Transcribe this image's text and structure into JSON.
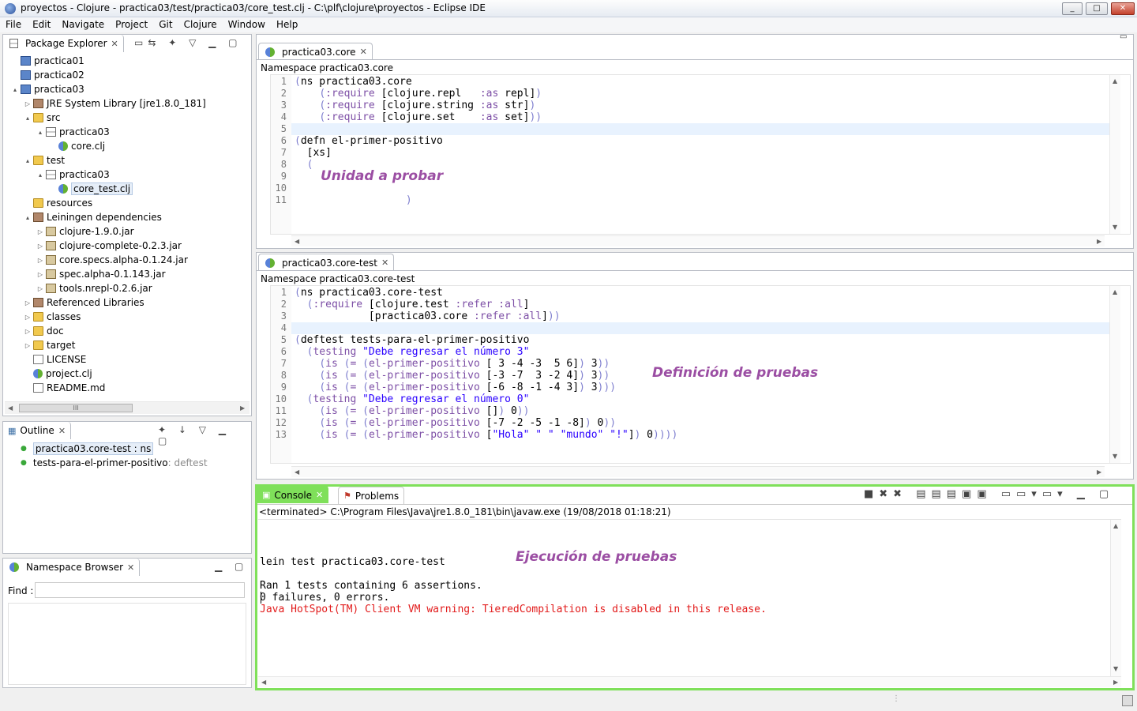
{
  "window": {
    "title": "proyectos - Clojure - practica03/test/practica03/core_test.clj - C:\\plf\\clojure\\proyectos - Eclipse IDE",
    "min": "_",
    "max": "□",
    "close": "✕"
  },
  "menu": [
    "File",
    "Edit",
    "Navigate",
    "Project",
    "Git",
    "Clojure",
    "Window",
    "Help"
  ],
  "package_explorer": {
    "title": "Package Explorer",
    "items": [
      {
        "label": "practica01"
      },
      {
        "label": "practica02"
      },
      {
        "label": "practica03"
      },
      {
        "label": "JRE System Library [jre1.8.0_181]"
      },
      {
        "label": "src"
      },
      {
        "label": "practica03"
      },
      {
        "label": "core.clj"
      },
      {
        "label": "test"
      },
      {
        "label": "practica03"
      },
      {
        "label": "core_test.clj"
      },
      {
        "label": "resources"
      },
      {
        "label": "Leiningen dependencies"
      },
      {
        "label": "clojure-1.9.0.jar"
      },
      {
        "label": "clojure-complete-0.2.3.jar"
      },
      {
        "label": "core.specs.alpha-0.1.24.jar"
      },
      {
        "label": "spec.alpha-0.1.143.jar"
      },
      {
        "label": "tools.nrepl-0.2.6.jar"
      },
      {
        "label": "Referenced Libraries"
      },
      {
        "label": "classes"
      },
      {
        "label": "doc"
      },
      {
        "label": "target"
      },
      {
        "label": "LICENSE"
      },
      {
        "label": "project.clj"
      },
      {
        "label": "README.md"
      }
    ],
    "hscroll_thumb": "III"
  },
  "outline": {
    "title": "Outline",
    "items": [
      {
        "name": "practica03.core-test",
        "kind": " : ns"
      },
      {
        "name": "tests-para-el-primer-positivo",
        "kind": " : deftest"
      }
    ]
  },
  "ns_browser": {
    "title": "Namespace Browser",
    "find_label": "Find :",
    "find_value": ""
  },
  "editor1": {
    "tab": "practica03.core",
    "namespace": "Namespace practica03.core",
    "line_numbers": [
      "1",
      "2",
      "3",
      "4",
      "5",
      "6",
      "7",
      "8",
      "9",
      "10",
      "11"
    ],
    "annotation": "Unidad a probar"
  },
  "editor2": {
    "tab": "practica03.core-test",
    "namespace": "Namespace practica03.core-test",
    "line_numbers": [
      "1",
      "2",
      "3",
      "4",
      "5",
      "6",
      "7",
      "8",
      "9",
      "10",
      "11",
      "12",
      "13"
    ],
    "annotation": "Definición de pruebas"
  },
  "console": {
    "tab_console": "Console",
    "tab_problems": "Problems",
    "status": "<terminated> C:\\Program Files\\Java\\jre1.8.0_181\\bin\\javaw.exe (19/08/2018 01:18:21)",
    "lines": [
      "lein test practica03.core-test",
      "",
      "Ran 1 tests containing 6 assertions.",
      "0 failures, 0 errors."
    ],
    "warning": "Java HotSpot(TM) Client VM warning: TieredCompilation is disabled in this release.",
    "annotation": "Ejecución de pruebas"
  }
}
